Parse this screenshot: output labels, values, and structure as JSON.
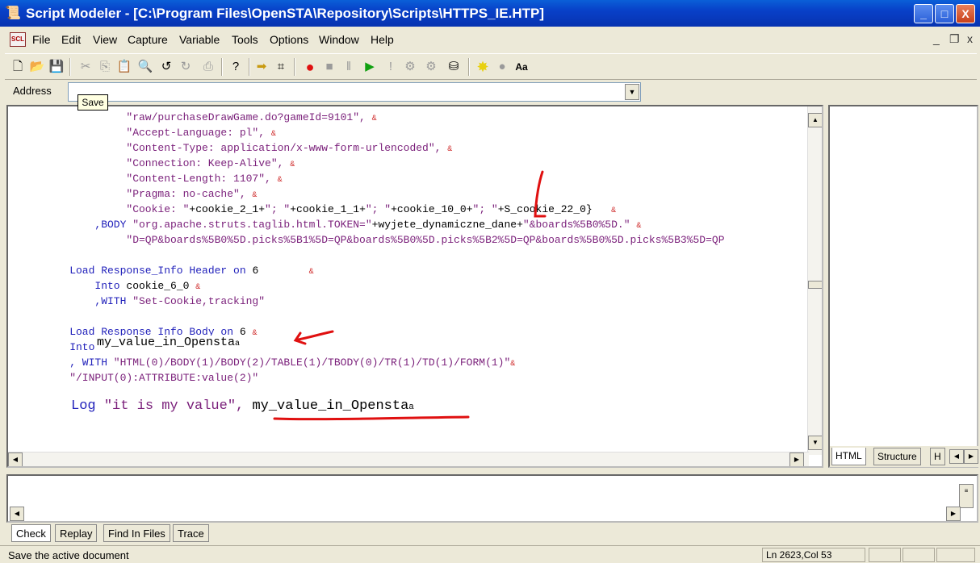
{
  "window": {
    "title": "Script Modeler - [C:\\Program Files\\OpenSTA\\Repository\\Scripts\\HTTPS_IE.HTP]",
    "minimize": "_",
    "maximize": "□",
    "close": "X"
  },
  "menu": {
    "items": [
      "File",
      "Edit",
      "View",
      "Capture",
      "Variable",
      "Tools",
      "Options",
      "Window",
      "Help"
    ],
    "doc_icon": "SCL",
    "mdi_controls": [
      "_",
      "̅",
      "x"
    ]
  },
  "toolbar": {
    "icons": [
      "new-icon",
      "open-icon",
      "save-icon",
      "cut-icon",
      "copy-icon",
      "paste-icon",
      "find-icon",
      "undo-icon",
      "redo-icon",
      "print-icon",
      "help-icon",
      "forward-icon",
      "binoculars-icon",
      "record-icon",
      "stop-icon",
      "pause-icon",
      "play-icon",
      "step-icon",
      "compile-icon",
      "gear-icon",
      "drive-icon",
      "star-icon",
      "dot-icon",
      "font-icon"
    ]
  },
  "address": {
    "label": "Address",
    "value": ""
  },
  "tooltip": {
    "text": "Save"
  },
  "editor": {
    "lines": [
      {
        "indent": 18,
        "parts": [
          {
            "t": "\"raw/purchaseDrawGame.do?gameId=9101\", ",
            "c": "str"
          },
          {
            "t": "&",
            "c": "amp"
          }
        ]
      },
      {
        "indent": 18,
        "parts": [
          {
            "t": "\"Accept-Language: pl\", ",
            "c": "str"
          },
          {
            "t": "&",
            "c": "amp"
          }
        ]
      },
      {
        "indent": 18,
        "parts": [
          {
            "t": "\"Content-Type: application/x-www-form-urlencoded\", ",
            "c": "str"
          },
          {
            "t": "&",
            "c": "amp"
          }
        ]
      },
      {
        "indent": 18,
        "parts": [
          {
            "t": "\"Connection: Keep-Alive\", ",
            "c": "str"
          },
          {
            "t": "&",
            "c": "amp"
          }
        ]
      },
      {
        "indent": 18,
        "parts": [
          {
            "t": "\"Content-Length: 1107\", ",
            "c": "str"
          },
          {
            "t": "&",
            "c": "amp"
          }
        ]
      },
      {
        "indent": 18,
        "parts": [
          {
            "t": "\"Pragma: no-cache\", ",
            "c": "str"
          },
          {
            "t": "&",
            "c": "amp"
          }
        ]
      },
      {
        "indent": 18,
        "parts": [
          {
            "t": "\"Cookie: \"",
            "c": "str"
          },
          {
            "t": "+cookie_2_1+",
            "c": "plain"
          },
          {
            "t": "\"; \"",
            "c": "str"
          },
          {
            "t": "+cookie_1_1+",
            "c": "plain"
          },
          {
            "t": "\"; \"",
            "c": "str"
          },
          {
            "t": "+cookie_10_0+",
            "c": "plain"
          },
          {
            "t": "\"; \"",
            "c": "str"
          },
          {
            "t": "+S_cookie_22_0}   ",
            "c": "plain"
          },
          {
            "t": "&",
            "c": "amp"
          }
        ]
      },
      {
        "indent": 13,
        "parts": [
          {
            "t": ",BODY ",
            "c": "kw"
          },
          {
            "t": "\"org.apache.struts.taglib.html.TOKEN=\"",
            "c": "str"
          },
          {
            "t": "+wyjete_dynamiczne_dane+",
            "c": "plain"
          },
          {
            "t": "\"&boards%5B0%5D.\" ",
            "c": "str"
          },
          {
            "t": "&",
            "c": "amp"
          }
        ]
      },
      {
        "indent": 18,
        "parts": [
          {
            "t": "\"D=QP&boards%5B0%5D.picks%5B1%5D=QP&boards%5B0%5D.picks%5B2%5D=QP&boards%5B0%5D.picks%5B3%5D=QP",
            "c": "str"
          }
        ]
      },
      {
        "indent": 0,
        "parts": []
      },
      {
        "indent": 9,
        "parts": [
          {
            "t": "Load Response_Info Header on ",
            "c": "kw"
          },
          {
            "t": "6        ",
            "c": "plain"
          },
          {
            "t": "&",
            "c": "amp"
          }
        ]
      },
      {
        "indent": 13,
        "parts": [
          {
            "t": "Into ",
            "c": "kw"
          },
          {
            "t": "cookie_6_0 ",
            "c": "plain"
          },
          {
            "t": "&",
            "c": "amp"
          }
        ]
      },
      {
        "indent": 13,
        "parts": [
          {
            "t": ",WITH ",
            "c": "kw"
          },
          {
            "t": "\"Set-Cookie,tracking\"",
            "c": "str"
          }
        ]
      },
      {
        "indent": 0,
        "parts": []
      },
      {
        "indent": 9,
        "parts": [
          {
            "t": "Load Response_Info Body on ",
            "c": "kw"
          },
          {
            "t": "6 ",
            "c": "plain"
          },
          {
            "t": "&",
            "c": "amp"
          }
        ]
      },
      {
        "indent": 9,
        "parts": [
          {
            "t": "Into",
            "c": "kw"
          }
        ]
      },
      {
        "indent": 9,
        "parts": [
          {
            "t": ", WITH ",
            "c": "kw"
          },
          {
            "t": "\"HTML(0)/BODY(1)/BODY(2)/TABLE(1)/TBODY(0)/TR(1)/TD(1)/FORM(1)\"",
            "c": "str"
          },
          {
            "t": "&",
            "c": "amp"
          }
        ]
      },
      {
        "indent": 9,
        "parts": [
          {
            "t": "\"/INPUT(0):ATTRIBUTE:value(2)\"",
            "c": "str"
          }
        ]
      }
    ]
  },
  "annotations": {
    "into_value": "my_value_in_Opensta",
    "into_suffix": "a",
    "log_keyword": "Log ",
    "log_string": "\"it is my value\", ",
    "log_var": "my_value_in_Opensta",
    "log_suffix": "a",
    "mark_color": "#e01010"
  },
  "right_tabs": [
    "HTML",
    "Structure",
    "H"
  ],
  "bottom_tabs": [
    "Check",
    "Replay",
    "Find In Files",
    "Trace"
  ],
  "status": {
    "message": "Save the active document",
    "position": "Ln 2623,Col 53"
  }
}
